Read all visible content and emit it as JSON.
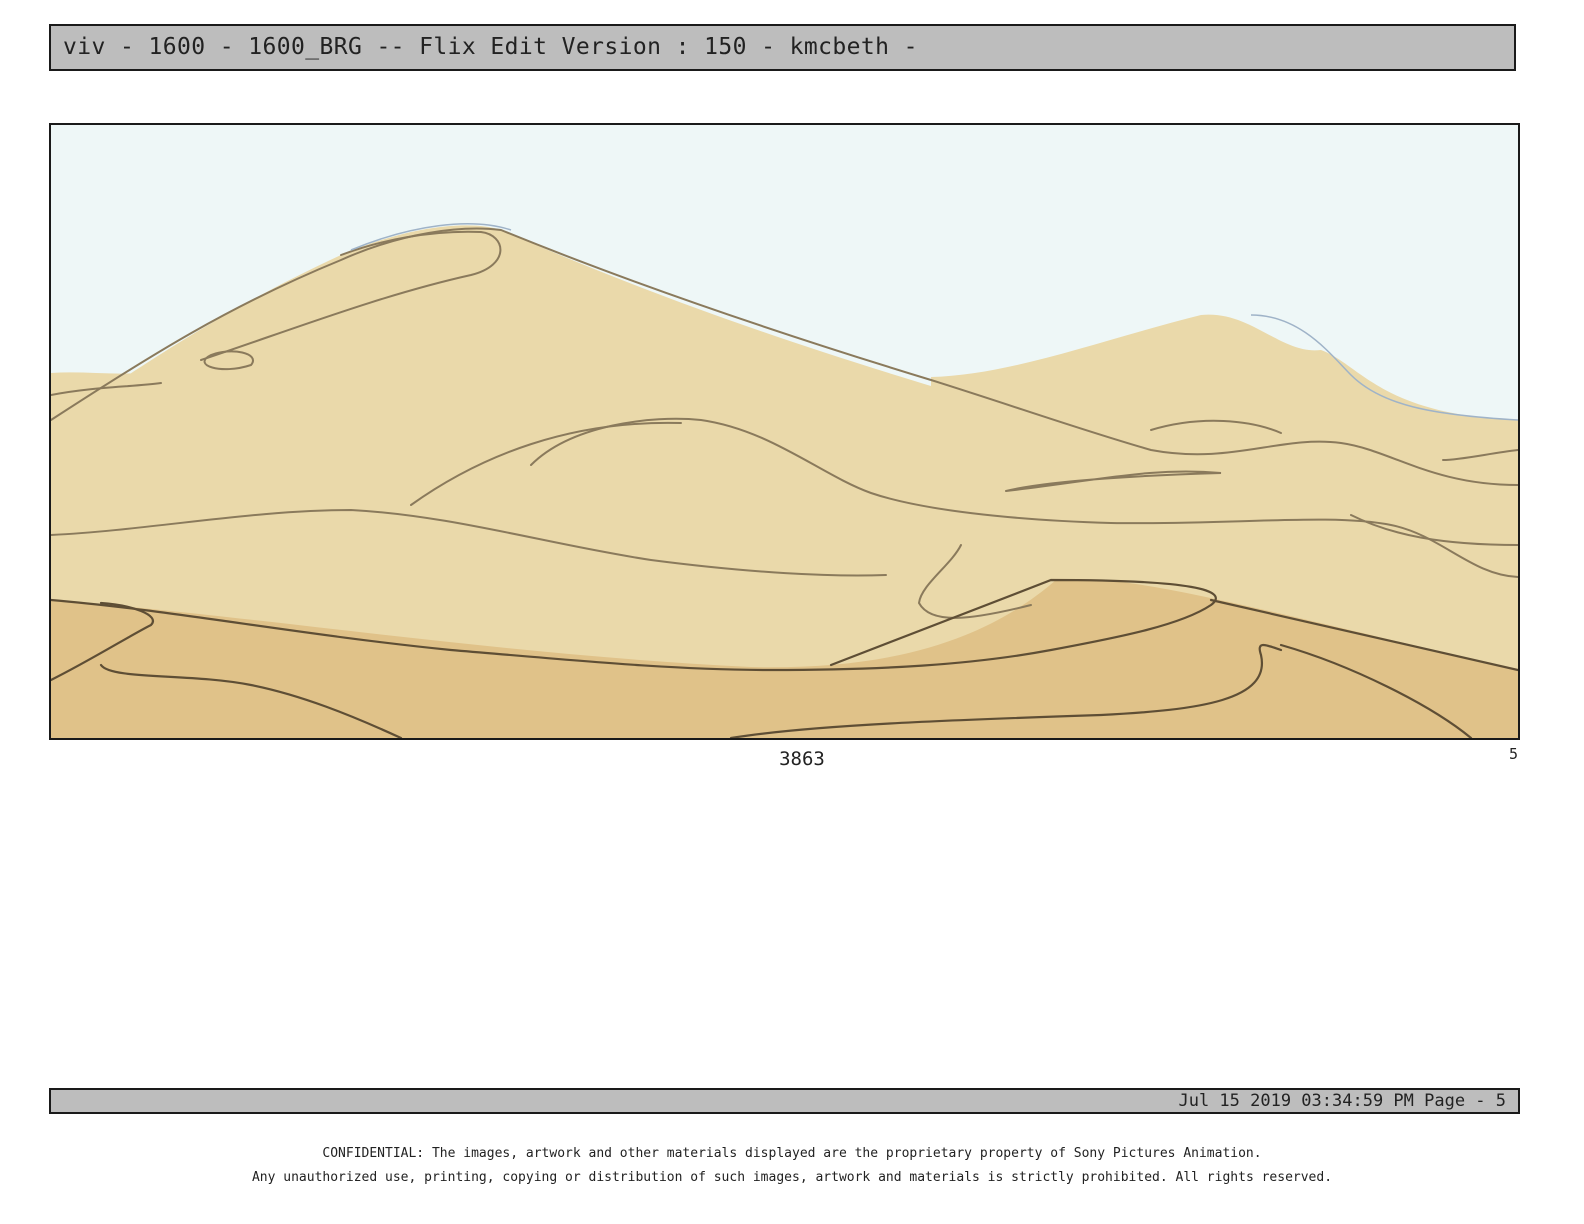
{
  "header": {
    "title": "viv - 1600 - 1600_BRG -- Flix Edit Version : 150 - kmcbeth -"
  },
  "panel": {
    "number": "3863",
    "corner_index": "5",
    "colors": {
      "sky": "#eef7f7",
      "sand_light": "#ead9aa",
      "sand_dark": "#e0c289",
      "line": "#8a7a5c",
      "line_dark": "#5e4e35"
    }
  },
  "footer": {
    "timestamp": "Jul 15 2019 03:34:59 PM Page - 5",
    "confidential_line1": "CONFIDENTIAL: The images, artwork and other materials displayed are the proprietary property of Sony Pictures Animation.",
    "confidential_line2": "Any unauthorized use, printing, copying or distribution of such images, artwork and materials is strictly prohibited. All rights reserved."
  }
}
